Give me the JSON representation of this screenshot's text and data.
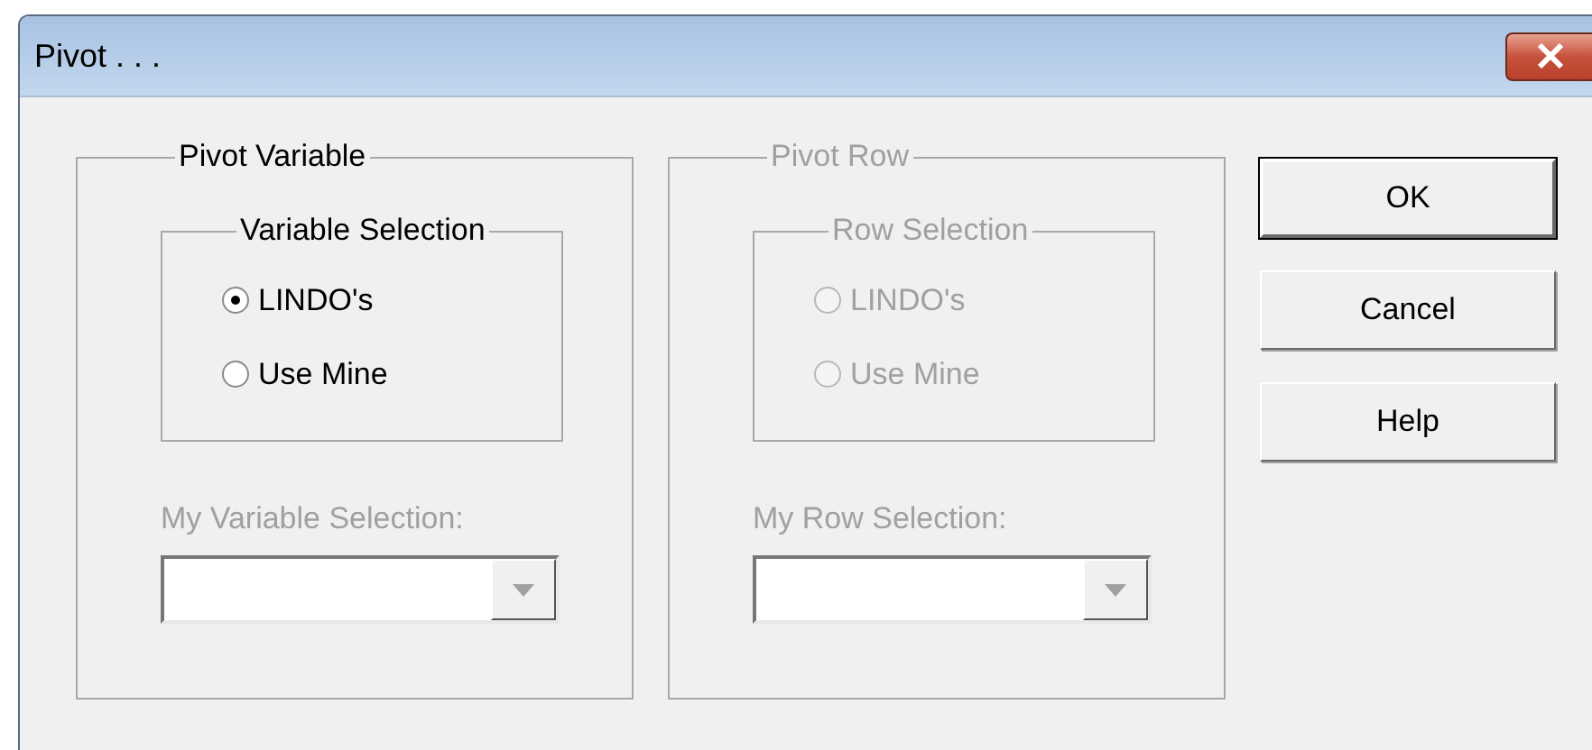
{
  "window": {
    "title": "Pivot . . ."
  },
  "groups": [
    {
      "title": "Pivot Variable",
      "disabled": false,
      "selection": {
        "title": "Variable Selection",
        "options": [
          {
            "label": "LINDO's",
            "selected": true
          },
          {
            "label": "Use Mine",
            "selected": false
          }
        ]
      },
      "my_selection": {
        "label": "My Variable Selection:",
        "disabled": true
      }
    },
    {
      "title": "Pivot Row",
      "disabled": true,
      "selection": {
        "title": "Row Selection",
        "options": [
          {
            "label": "LINDO's",
            "selected": false
          },
          {
            "label": "Use Mine",
            "selected": false
          }
        ]
      },
      "my_selection": {
        "label": "My Row Selection:",
        "disabled": true
      }
    }
  ],
  "buttons": [
    {
      "label": "OK",
      "default": true
    },
    {
      "label": "Cancel",
      "default": false
    },
    {
      "label": "Help",
      "default": false
    }
  ]
}
